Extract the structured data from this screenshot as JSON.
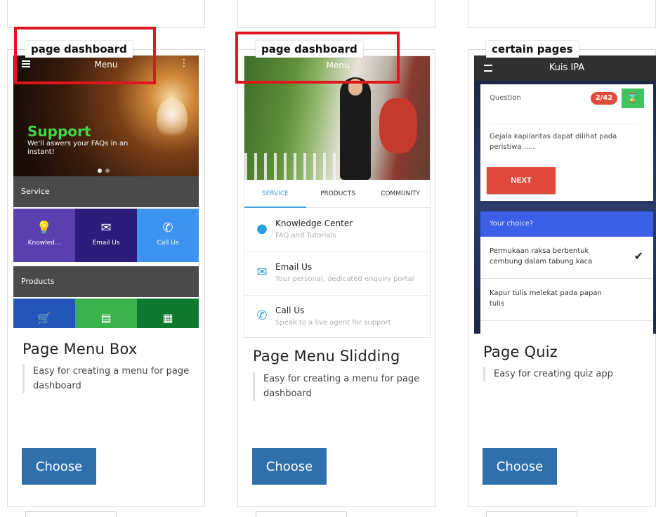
{
  "cards": [
    {
      "title": "Page Menu Box",
      "description": "Easy for creating a menu for page dashboard",
      "button": "Choose",
      "callout": "page dashboard",
      "preview": {
        "header_title": "Menu",
        "hero_title": "Support",
        "hero_subtitle": "We'll aswers your FAQs in an instant!",
        "section_service": "Service",
        "tiles": [
          "Knowled...",
          "Email Us",
          "Call Us"
        ],
        "section_products": "Products"
      }
    },
    {
      "title": "Page Menu Slidding",
      "description": "Easy for creating a menu for page dashboard",
      "button": "Choose",
      "callout": "page dashboard",
      "preview": {
        "header_title": "Menu",
        "tabs": [
          "SERVICE",
          "PRODUCTS",
          "COMMUNITY"
        ],
        "items": [
          {
            "title": "Knowledge Center",
            "subtitle": "FAQ and Tutorials"
          },
          {
            "title": "Email Us",
            "subtitle": "Your personal, dedicated enquiry portal"
          },
          {
            "title": "Call Us",
            "subtitle": "Speak to a live agent for support"
          }
        ]
      }
    },
    {
      "title": "Page Quiz",
      "description": "Easy for creating quiz app",
      "button": "Choose",
      "callout": "certain pages",
      "preview": {
        "header_title": "Kuis IPA",
        "question_label": "Question",
        "counter": "2/42",
        "question": "Gejala kapilaritas dapat dilihat pada peristiwa .....",
        "next": "NEXT",
        "choice_header": "Your choice?",
        "options": [
          "Permukaan raksa berbentuk cembung dalam tabung kaca",
          "Kapur tulis melekat pada papan tulis"
        ]
      }
    }
  ],
  "colors": {
    "callout_border": "#e2151f",
    "button_bg": "#2f6fab",
    "support_green": "#44d64a",
    "tab_active": "#3ea0e0",
    "quiz_red": "#e04a3c",
    "quiz_green": "#3fc35c",
    "quiz_blue": "#3b5fe6"
  }
}
